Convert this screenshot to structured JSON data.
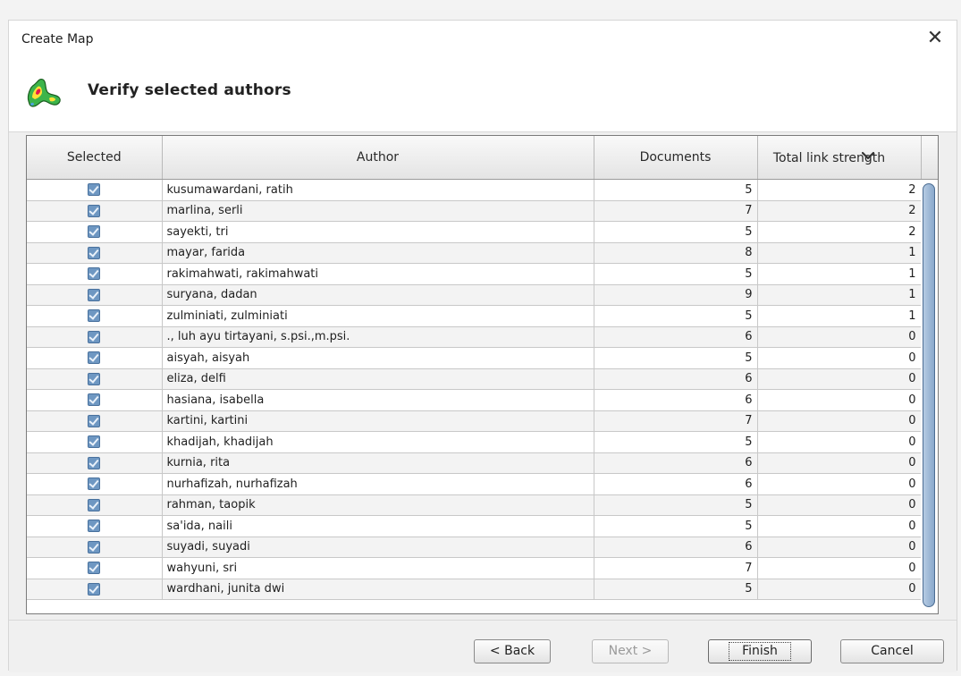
{
  "window": {
    "title": "Create Map",
    "close_symbol": "✕"
  },
  "header": {
    "title": "Verify selected authors",
    "icon": "vosviewer-app-icon"
  },
  "table": {
    "columns": [
      "Selected",
      "Author",
      "Documents",
      "Total link strength"
    ],
    "sorted_column": "Total link strength",
    "sort_direction": "descending",
    "rows": [
      {
        "selected": true,
        "author": "kusumawardani, ratih",
        "documents": "5",
        "total_link_strength": "2"
      },
      {
        "selected": true,
        "author": "marlina, serli",
        "documents": "7",
        "total_link_strength": "2"
      },
      {
        "selected": true,
        "author": "sayekti, tri",
        "documents": "5",
        "total_link_strength": "2"
      },
      {
        "selected": true,
        "author": "mayar, farida",
        "documents": "8",
        "total_link_strength": "1"
      },
      {
        "selected": true,
        "author": "rakimahwati, rakimahwati",
        "documents": "5",
        "total_link_strength": "1"
      },
      {
        "selected": true,
        "author": "suryana, dadan",
        "documents": "9",
        "total_link_strength": "1"
      },
      {
        "selected": true,
        "author": "zulminiati, zulminiati",
        "documents": "5",
        "total_link_strength": "1"
      },
      {
        "selected": true,
        "author": "., luh ayu tirtayani, s.psi.,m.psi.",
        "documents": "6",
        "total_link_strength": "0"
      },
      {
        "selected": true,
        "author": "aisyah, aisyah",
        "documents": "5",
        "total_link_strength": "0"
      },
      {
        "selected": true,
        "author": "eliza, delfi",
        "documents": "6",
        "total_link_strength": "0"
      },
      {
        "selected": true,
        "author": "hasiana, isabella",
        "documents": "6",
        "total_link_strength": "0"
      },
      {
        "selected": true,
        "author": "kartini, kartini",
        "documents": "7",
        "total_link_strength": "0"
      },
      {
        "selected": true,
        "author": "khadijah, khadijah",
        "documents": "5",
        "total_link_strength": "0"
      },
      {
        "selected": true,
        "author": "kurnia, rita",
        "documents": "6",
        "total_link_strength": "0"
      },
      {
        "selected": true,
        "author": "nurhafizah, nurhafizah",
        "documents": "6",
        "total_link_strength": "0"
      },
      {
        "selected": true,
        "author": "rahman, taopik",
        "documents": "5",
        "total_link_strength": "0"
      },
      {
        "selected": true,
        "author": "sa'ida, naili",
        "documents": "5",
        "total_link_strength": "0"
      },
      {
        "selected": true,
        "author": "suyadi, suyadi",
        "documents": "6",
        "total_link_strength": "0"
      },
      {
        "selected": true,
        "author": "wahyuni, sri",
        "documents": "7",
        "total_link_strength": "0"
      },
      {
        "selected": true,
        "author": "wardhani, junita dwi",
        "documents": "5",
        "total_link_strength": "0"
      }
    ]
  },
  "buttons": {
    "back": "< Back",
    "next": "Next >",
    "finish": "Finish",
    "cancel": "Cancel",
    "next_enabled": false,
    "default_button": "finish"
  },
  "colors": {
    "checkbox": "#6e97c2",
    "scroll_thumb": "#9bb6d5"
  }
}
